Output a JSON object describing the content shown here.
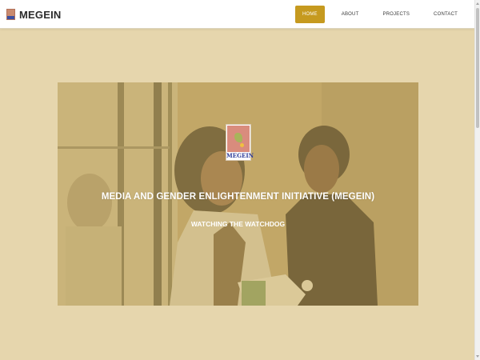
{
  "header": {
    "brand_name": "MEGEIN",
    "nav": [
      {
        "label": "HOME",
        "active": true
      },
      {
        "label": "ABOUT",
        "active": false
      },
      {
        "label": "PROJECTS",
        "active": false
      },
      {
        "label": "CONTACT",
        "active": false
      }
    ]
  },
  "hero": {
    "logo_text": "MEGEIN",
    "title": "MEDIA AND GENDER ENLIGHTENMENT INITIATIVE (MEGEIN)",
    "subtitle": "WATCHING THE WATCHDOG"
  },
  "colors": {
    "page_background": "#e6d6ad",
    "nav_active": "#c69a1f",
    "overlay": "#cdaf64"
  }
}
